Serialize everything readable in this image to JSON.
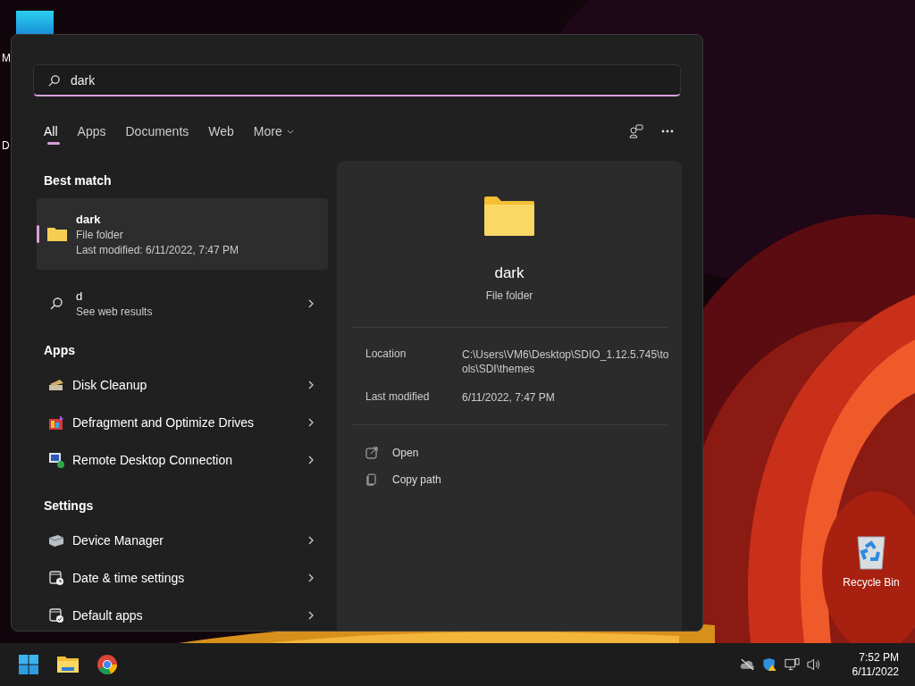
{
  "desktop": {
    "icons": [
      {
        "label": "M"
      },
      {
        "label": "D"
      }
    ],
    "recycle_bin": {
      "label": "Recycle Bin"
    }
  },
  "search": {
    "value": "dark"
  },
  "filter_tabs": [
    {
      "label": "All",
      "selected": true,
      "kind": "tab"
    },
    {
      "label": "Apps",
      "selected": false,
      "kind": "tab"
    },
    {
      "label": "Documents",
      "selected": false,
      "kind": "tab"
    },
    {
      "label": "Web",
      "selected": false,
      "kind": "tab"
    },
    {
      "label": "More",
      "selected": false,
      "kind": "dropdown"
    }
  ],
  "best_match": {
    "heading": "Best match",
    "name": "dark",
    "type": "File folder",
    "modified": "Last modified: 6/11/2022, 7:47 PM",
    "selected": true
  },
  "web_result": {
    "query": "d",
    "hint": "See web results"
  },
  "sections": [
    {
      "heading": "Apps",
      "items": [
        {
          "label": "Disk Cleanup",
          "kind": "disk-cleanup"
        },
        {
          "label": "Defragment and Optimize Drives",
          "kind": "defrag"
        },
        {
          "label": "Remote Desktop Connection",
          "kind": "remote"
        }
      ]
    },
    {
      "heading": "Settings",
      "items": [
        {
          "label": "Device Manager",
          "kind": "device"
        },
        {
          "label": "Date & time settings",
          "kind": "clock"
        },
        {
          "label": "Default apps",
          "kind": "check"
        }
      ]
    }
  ],
  "preview": {
    "name": "dark",
    "type": "File folder",
    "details": [
      {
        "label": "Location",
        "value": "C:\\Users\\VM6\\Desktop\\SDIO_1.12.5.745\\tools\\SDI\\themes"
      },
      {
        "label": "Last modified",
        "value": "6/11/2022, 7:47 PM"
      }
    ],
    "actions": [
      {
        "label": "Open",
        "kind": "open"
      },
      {
        "label": "Copy path",
        "kind": "copy"
      }
    ]
  },
  "taskbar": {
    "time": "7:52 PM",
    "date": "6/11/2022"
  }
}
